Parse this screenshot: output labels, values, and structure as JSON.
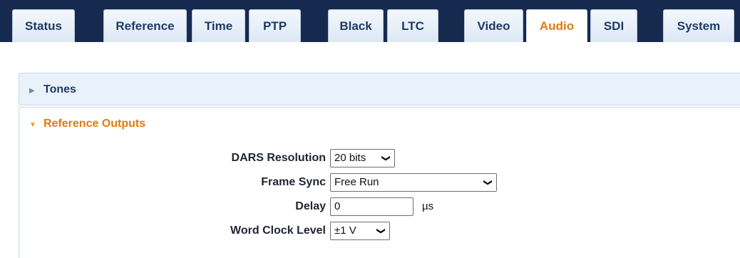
{
  "tabs": [
    {
      "label": "Status"
    },
    {
      "label": "Reference"
    },
    {
      "label": "Time"
    },
    {
      "label": "PTP"
    },
    {
      "label": "Black"
    },
    {
      "label": "LTC"
    },
    {
      "label": "Video"
    },
    {
      "label": "Audio",
      "active": true
    },
    {
      "label": "SDI"
    },
    {
      "label": "System"
    }
  ],
  "sections": {
    "tones": {
      "title": "Tones",
      "expanded": false
    },
    "reference_outputs": {
      "title": "Reference Outputs",
      "expanded": true
    }
  },
  "form": {
    "dars_resolution": {
      "label": "DARS Resolution",
      "value": "20 bits"
    },
    "frame_sync": {
      "label": "Frame Sync",
      "value": "Free Run"
    },
    "delay": {
      "label": "Delay",
      "value": "0",
      "unit": "µs"
    },
    "word_clock_level": {
      "label": "Word Clock Level",
      "value": "±1 V"
    }
  },
  "colors": {
    "tabbar_bg": "#162a4f",
    "active_tab_text": "#e07a10",
    "tab_text": "#1e3a66",
    "section_header_bg": "#e9f2fb"
  },
  "icons": {
    "collapsed": "triangle-right-icon",
    "expanded": "triangle-down-icon",
    "select": "chevron-down-icon"
  }
}
